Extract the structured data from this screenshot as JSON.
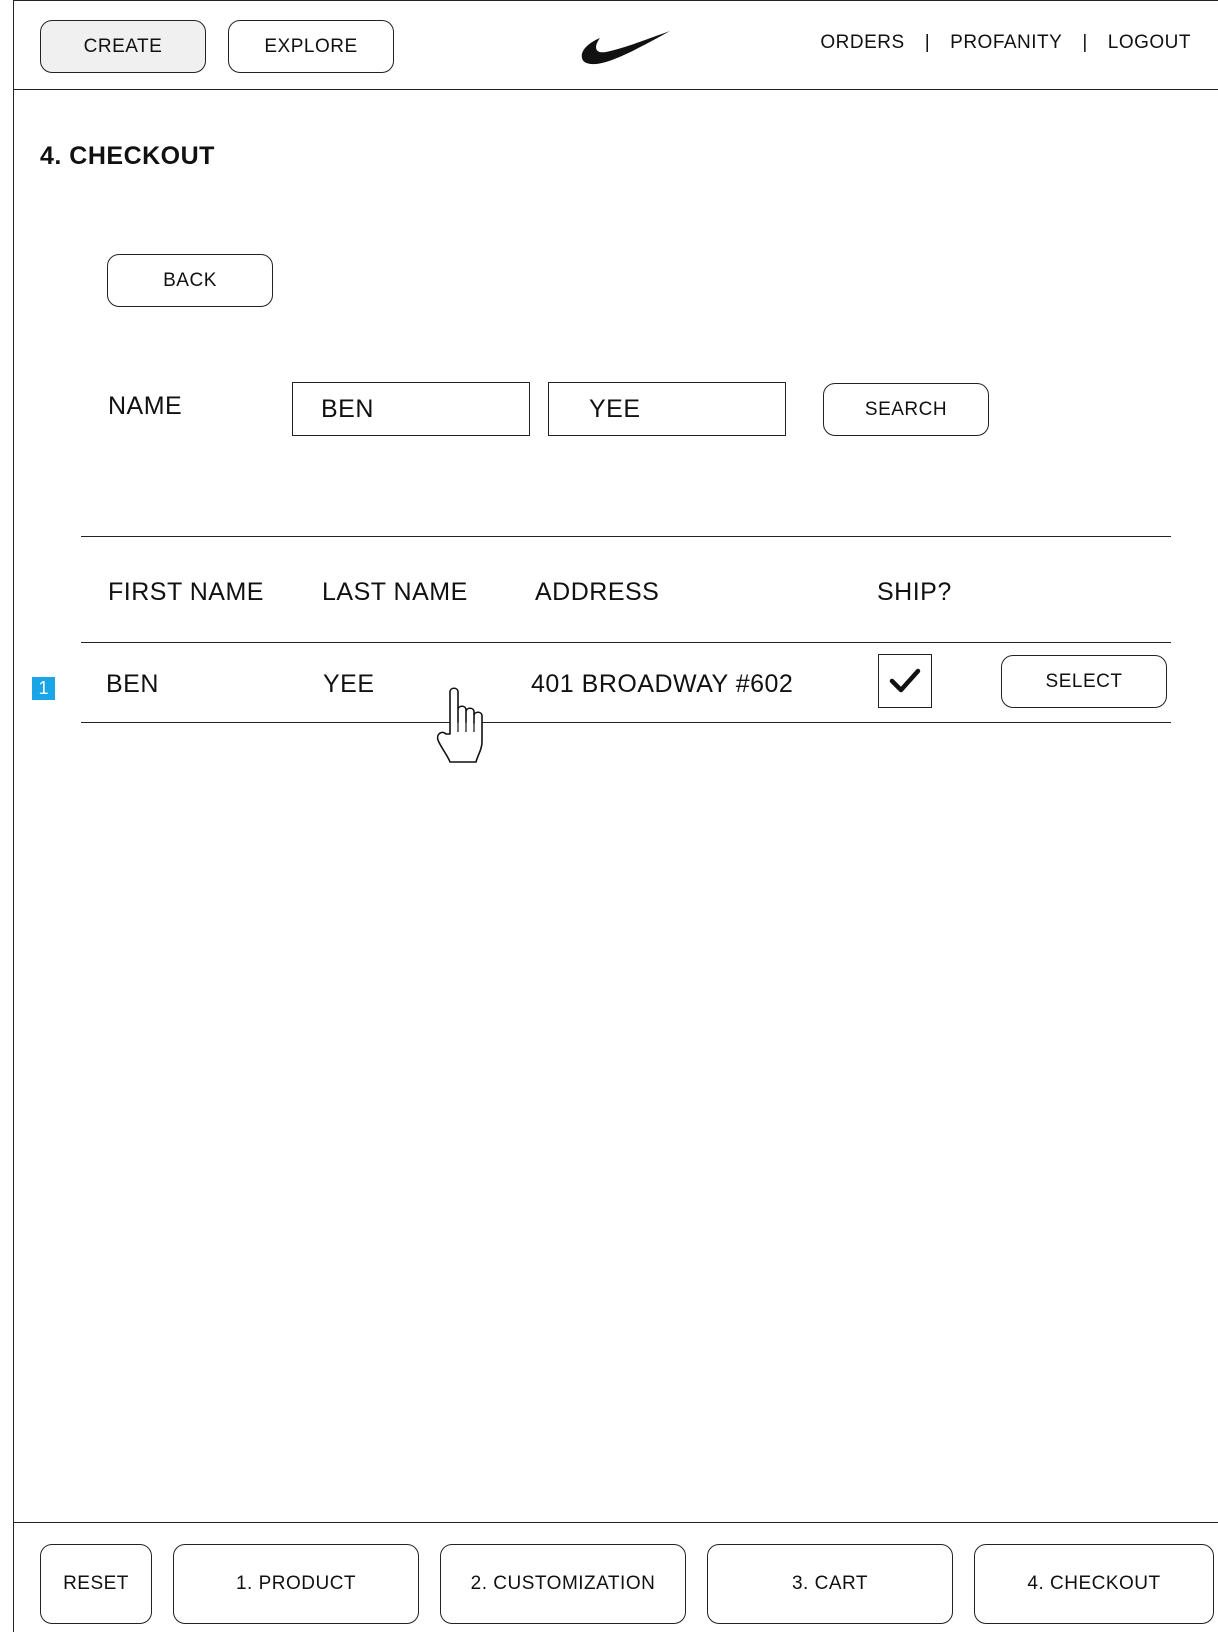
{
  "header": {
    "create_label": "CREATE",
    "explore_label": "EXPLORE",
    "logo_icon": "swoosh-logo",
    "links": {
      "orders": "ORDERS",
      "profanity": "PROFANITY",
      "logout": "LOGOUT",
      "separator": "|"
    }
  },
  "page": {
    "title": "4. CHECKOUT",
    "back_label": "BACK"
  },
  "search": {
    "name_label": "NAME",
    "first_name_value": "BEN",
    "last_name_value": "YEE",
    "search_label": "SEARCH"
  },
  "table": {
    "headers": {
      "first_name": "FIRST NAME",
      "last_name": "LAST NAME",
      "address": "ADDRESS",
      "ship": "SHIP?"
    },
    "rows": [
      {
        "row_number": "1",
        "first_name": "BEN",
        "last_name": "YEE",
        "address": "401 BROADWAY #602",
        "ship_checked": true,
        "select_label": "SELECT"
      }
    ]
  },
  "footer": {
    "reset_label": "RESET",
    "steps": [
      "1. PRODUCT",
      "2. CUSTOMIZATION",
      "3. CART",
      "4. CHECKOUT"
    ]
  },
  "colors": {
    "row_badge": "#1aa5e6",
    "border": "#222222",
    "active_button_bg": "#f0f0f0"
  }
}
